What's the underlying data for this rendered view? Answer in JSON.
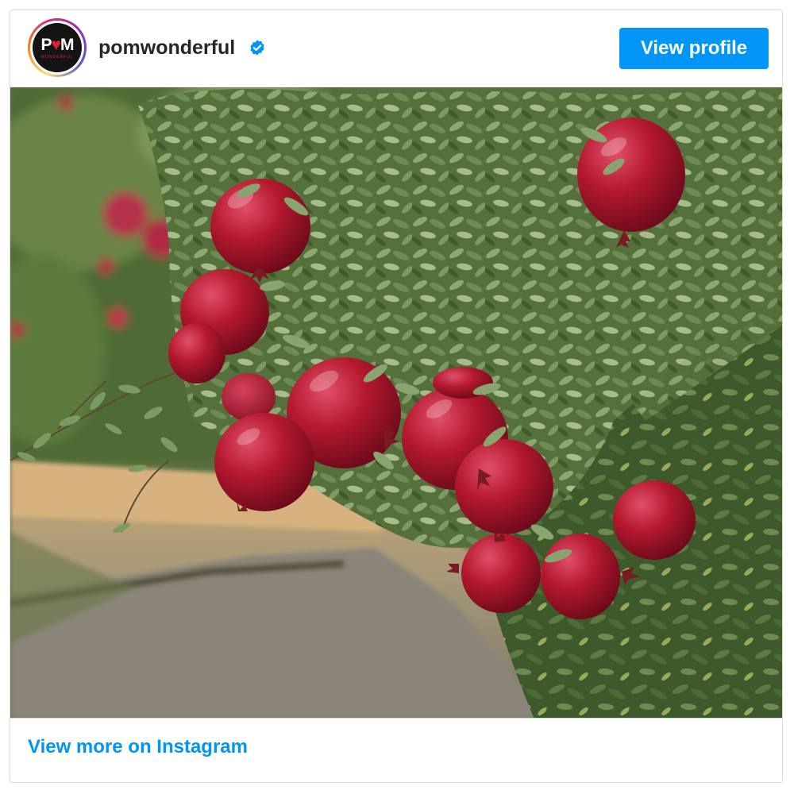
{
  "post": {
    "avatar": {
      "logo_left": "P",
      "logo_heart": "♥",
      "logo_right": "M",
      "logo_sub": "WONDERFUL"
    },
    "username": "pomwonderful",
    "verified": true,
    "view_profile_label": "View profile",
    "photo_icon": "pomegranate-tree-photo",
    "footer_link_label": "View more on Instagram"
  },
  "colors": {
    "accent": "#0095f6",
    "text": "#262626",
    "border": "#dbdbdb",
    "pomegranate": "#b5192f",
    "foliage": "#4f6b3a"
  }
}
